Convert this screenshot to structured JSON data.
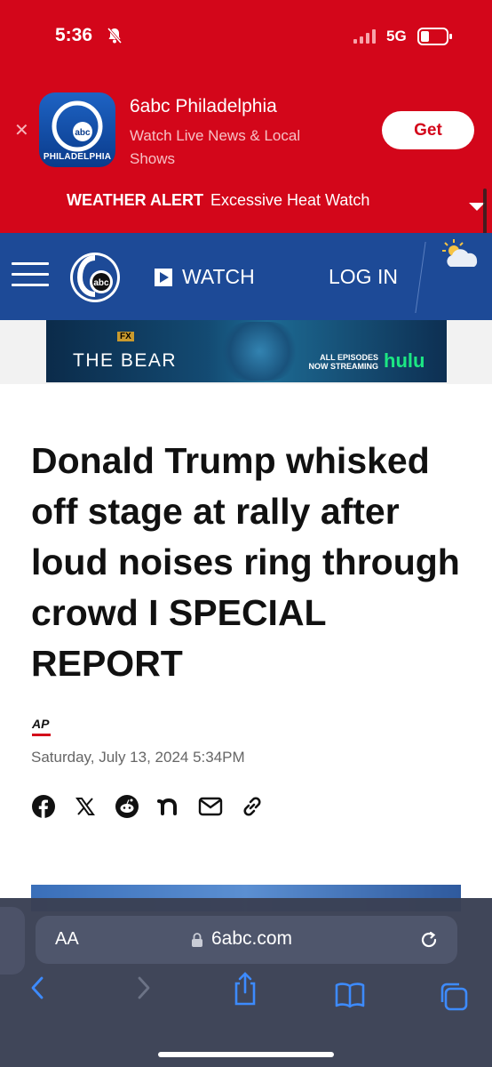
{
  "status": {
    "time": "5:36",
    "network": "5G"
  },
  "app_banner": {
    "name": "6abc Philadelphia",
    "subtitle": "Watch Live News & Local Shows",
    "icon_label": "PHILADELPHIA",
    "get_label": "Get"
  },
  "weather_alert": {
    "label": "WEATHER ALERT",
    "text": "Excessive Heat Watch"
  },
  "nav": {
    "watch_label": "WATCH",
    "login_label": "LOG IN",
    "logo_text": "abc"
  },
  "ad": {
    "network": "FX",
    "title": "THE BEAR",
    "streaming": "ALL EPISODES NOW STREAMING",
    "brand": "hulu"
  },
  "article": {
    "headline": "Donald Trump whisked off stage at rally after loud noises ring through crowd I SPECIAL REPORT",
    "source": "AP",
    "date": "Saturday, July 13, 2024 5:34PM"
  },
  "share_icons": [
    "facebook-icon",
    "x-icon",
    "reddit-icon",
    "nextdoor-icon",
    "email-icon",
    "link-icon"
  ],
  "browser": {
    "text_size_label": "AA",
    "url": "6abc.com"
  },
  "colors": {
    "alert_red": "#d3061a",
    "nav_blue": "#1d4a97",
    "hulu_green": "#1ce783"
  }
}
